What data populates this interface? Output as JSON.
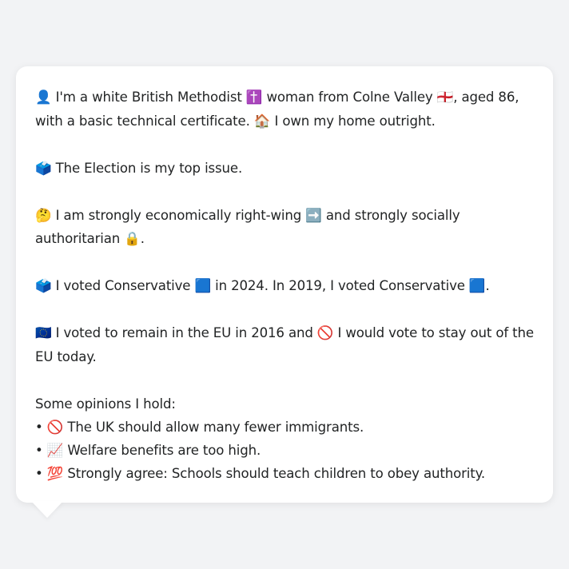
{
  "profile": {
    "p1_line1": "👤 I'm a white British Methodist ✝️ woman from Colne Valley 🏴󠁧󠁢󠁥󠁮󠁧󠁿, aged 86,",
    "p1_line2": "with a basic technical certificate. 🏠 I own my home outright.",
    "p2": "🗳️ The Election is my top issue.",
    "p3_line1": "🤔 I am strongly economically right-wing ➡️ and strongly socially",
    "p3_line2": "authoritarian 🔒.",
    "p4": "🗳️ I voted Conservative 🟦 in 2024. In 2019, I voted Conservative 🟦.",
    "p5_line1": "🇪🇺 I voted to remain in the EU in 2016 and 🚫 I would vote to stay out of the",
    "p5_line2": "EU today.",
    "opinions_heading": "Some opinions I hold:",
    "opinions": [
      "• 🚫 The UK should allow many fewer immigrants.",
      "• 📈 Welfare benefits are too high.",
      "• 💯 Strongly agree: Schools should teach children to obey authority."
    ]
  },
  "colors": {
    "background": "#f2f3f5",
    "bubble": "#ffffff",
    "text": "#222425"
  }
}
